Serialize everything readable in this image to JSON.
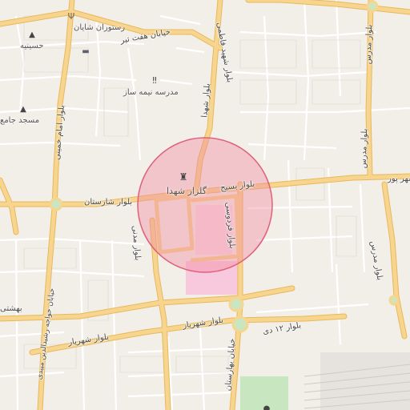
{
  "roads": {
    "boulevard_shariati": "بلوار شارستان",
    "boulevard_basij": "بلوار بسیج",
    "boulevard_shahriar": "بلوار شهریار",
    "boulevard_shohada_north": "بلوار شهدا",
    "boulevard_madani": "بلوار مدنی",
    "boulevard_ferdowsi": "بلوار فردوسی",
    "boulevard_ferdowsi_south": "خیابان بهارستان",
    "boulevard_dey": "بلوار ۱۲ دی",
    "khayyam_khajeh": "خیابان خواجه رشیدالدین میبدی",
    "imam_khomeini": "بلوار امام خمینی",
    "modares_east": "بلوار مدرس",
    "modares_lower": "بلوار مدرس",
    "haft_tir": "خیابان هفت تیر",
    "beheshti": "بهشتی",
    "shahid_fahimi": "بلوار شهید فاطمی",
    "mastoor": "شهر پور",
    "west_short": "بلوار",
    "north_short": "خیابان"
  },
  "pois": {
    "restaurant": "رستوران شایان",
    "husseiniya": "حسینیه",
    "school": "مدرسه نیمه ساز",
    "mosque": "مسجد جامع",
    "golzar": "گلزار شهدا"
  },
  "colors": {
    "background": "#f2efe9",
    "major_road": "#f7d58e",
    "major_road_edge": "#e8b85c",
    "minor_road": "#ffffff",
    "block_line": "#d9d4cc",
    "circle_fill": "#f08aa0",
    "circle_stroke": "#e0607a",
    "park": "#c8e6c0",
    "pink_area": "#f8c9dc",
    "grey_area": "#e3e0da"
  },
  "icons": {
    "fork_knife": "restaurant-icon",
    "lodging": "lodging-icon",
    "mosque": "mosque-icon",
    "school": "school-icon",
    "cemetery": "cemetery-icon"
  }
}
